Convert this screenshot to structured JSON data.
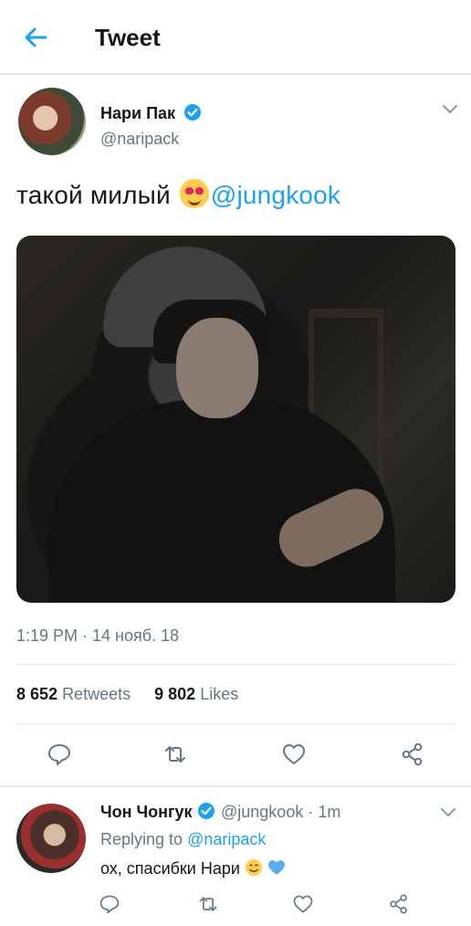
{
  "header": {
    "title": "Tweet"
  },
  "tweet": {
    "author_name": "Нари Пак",
    "author_handle": "@naripack",
    "text_before": "такой милый",
    "mention": "@jungkook",
    "timestamp": "1:19 PM · 14 нояб. 18",
    "retweets_count": "8 652",
    "retweets_label": "Retweets",
    "likes_count": "9 802",
    "likes_label": "Likes"
  },
  "reply": {
    "author_name": "Чон Чонгук",
    "author_handle": "@jungkook",
    "time": "· 1m",
    "replying_to_label": "Replying to",
    "replying_to_handle": "@naripack",
    "text": "ох, спасибки Нари"
  },
  "icons": [
    "back-arrow-icon",
    "verified-icon",
    "chevron-down-icon",
    "heart-eyes-emoji",
    "reply-icon",
    "retweet-icon",
    "like-icon",
    "share-icon",
    "smile-emoji",
    "blue-heart-emoji"
  ],
  "colors": {
    "accent": "#1da1f2",
    "secondary_text": "#657786",
    "divider": "#e1e8ed"
  }
}
